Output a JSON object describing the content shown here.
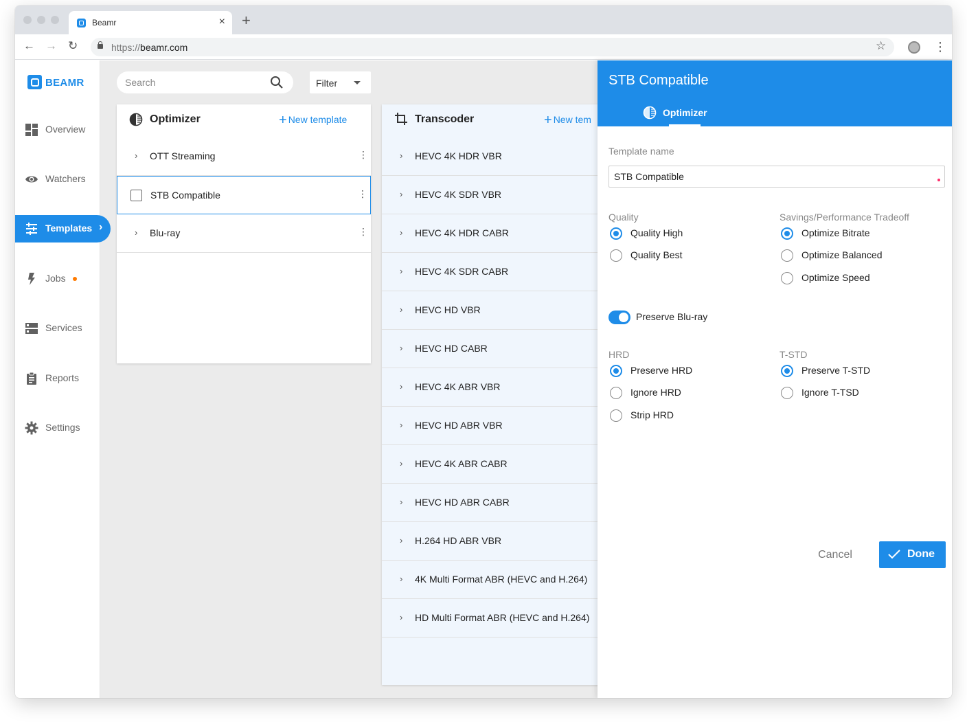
{
  "browser": {
    "tab_title": "Beamr",
    "url_protocol": "https://",
    "url_host": "beamr.com"
  },
  "sidebar": {
    "logo_text": "BEAMR",
    "items": [
      {
        "label": "Overview",
        "icon": "dashboard-icon"
      },
      {
        "label": "Watchers",
        "icon": "eye-icon"
      },
      {
        "label": "Templates",
        "icon": "sliders-icon",
        "active": true
      },
      {
        "label": "Jobs",
        "icon": "lightning-icon",
        "badge_color": "#ff7a00"
      },
      {
        "label": "Services",
        "icon": "server-icon"
      },
      {
        "label": "Reports",
        "icon": "clipboard-icon"
      },
      {
        "label": "Settings",
        "icon": "gear-icon"
      }
    ]
  },
  "toolbar": {
    "search_placeholder": "Search",
    "filter_label": "Filter"
  },
  "optimizer_panel": {
    "title": "Optimizer",
    "new_template_label": "New template",
    "items": [
      "OTT Streaming",
      "STB Compatible",
      "Blu-ray"
    ],
    "selected_index": 1
  },
  "transcoder_panel": {
    "title": "Transcoder",
    "new_template_label": "New tem",
    "items": [
      "HEVC 4K HDR VBR",
      "HEVC 4K SDR VBR",
      "HEVC 4K HDR CABR",
      "HEVC 4K SDR CABR",
      "HEVC HD VBR",
      "HEVC HD CABR",
      "HEVC 4K ABR VBR",
      "HEVC HD ABR VBR",
      "HEVC 4K ABR CABR",
      "HEVC HD ABR CABR",
      "H.264 HD ABR VBR",
      "4K Multi Format ABR (HEVC and H.264)",
      "HD Multi Format ABR (HEVC and H.264)"
    ]
  },
  "drawer": {
    "title": "STB Compatible",
    "tab_label": "Optimizer",
    "template_name_label": "Template name",
    "template_name_value": "STB Compatible",
    "quality": {
      "label": "Quality",
      "options": [
        "Quality High",
        "Quality Best"
      ],
      "selected": 0
    },
    "tradeoff": {
      "label": "Savings/Performance Tradeoff",
      "options": [
        "Optimize Bitrate",
        "Optimize Balanced",
        "Optimize Speed"
      ],
      "selected": 0
    },
    "preserve_bluray": {
      "label": "Preserve Blu-ray",
      "on": true
    },
    "hrd": {
      "label": "HRD",
      "options": [
        "Preserve HRD",
        "Ignore HRD",
        "Strip HRD"
      ],
      "selected": 0
    },
    "tstd": {
      "label": "T-STD",
      "options": [
        "Preserve T-STD",
        "Ignore T-TSD"
      ],
      "selected": 0
    },
    "cancel_label": "Cancel",
    "done_label": "Done"
  },
  "colors": {
    "accent": "#1e8ce8",
    "jobs_badge": "#ff7a00",
    "required_marker": "#ff2f6b"
  }
}
